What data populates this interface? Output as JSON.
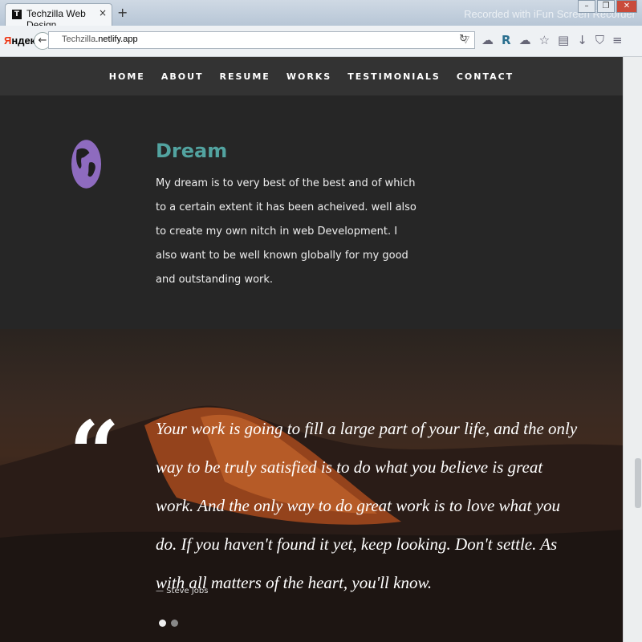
{
  "browser": {
    "tab_title": "Techzilla Web Design",
    "tab_favicon": "T",
    "tab_close": "×",
    "new_tab": "+",
    "watermark": "Recorded with iFun Screen Recorder",
    "yandex_ya": "Я",
    "yandex_rest": "ндекс",
    "url_host": "Techzilla",
    "url_domain": ".netlify.app",
    "icons": [
      "back-arrow-icon",
      "reload-icon",
      "weather-icon",
      "bookmark-r-icon",
      "weather-icon",
      "star-icon",
      "reading-list-icon",
      "download-icon",
      "shield-icon",
      "menu-icon"
    ]
  },
  "nav": {
    "items": [
      "HOME",
      "ABOUT",
      "RESUME",
      "WORKS",
      "TESTIMONIALS",
      "CONTACT"
    ]
  },
  "dream": {
    "icon": "globe-icon",
    "title": "Dream",
    "text": "My dream is to very best of the best and of which to a certain extent it has been acheived. well also to create my own nitch in web Development. I also want to be well known globally for my good and outstanding work."
  },
  "testimonial": {
    "quote": "Your work is going to fill a large part of your life, and the only way to be truly satisfied is to do what you believe is great work. And the only way to do great work is to love what you do. If you haven't found it yet, keep looking. Don't settle. As with all matters of the heart, you'll know.",
    "author": "— Steve Jobs",
    "quote_mark": "“"
  },
  "colors": {
    "accent": "#52a3a0",
    "globe": "#8e6bbf",
    "nav_bg": "#333333"
  }
}
